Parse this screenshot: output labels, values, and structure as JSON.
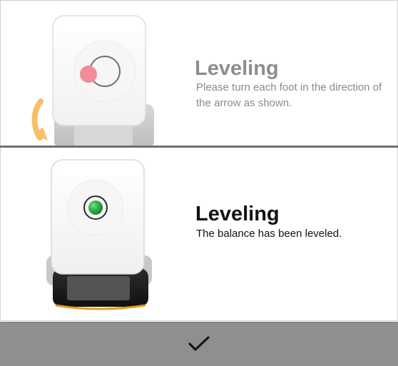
{
  "steps": {
    "instruction": {
      "title": "Leveling",
      "message": "Please turn each foot in the direction of the arrow as shown."
    },
    "complete": {
      "title": "Leveling",
      "message": "The balance has been leveled."
    }
  },
  "confirm_bar": {
    "icon": "checkmark-icon"
  },
  "colors": {
    "bubble_off": "#f28c9a",
    "bubble_ok": "#29a84a",
    "arrow": "#f4c06a",
    "status_inactive_text": "#8e8e8e",
    "status_active_text": "#111111",
    "base_accent": "#e59b1e",
    "confirm_bar_bg": "#8f8f8f"
  }
}
